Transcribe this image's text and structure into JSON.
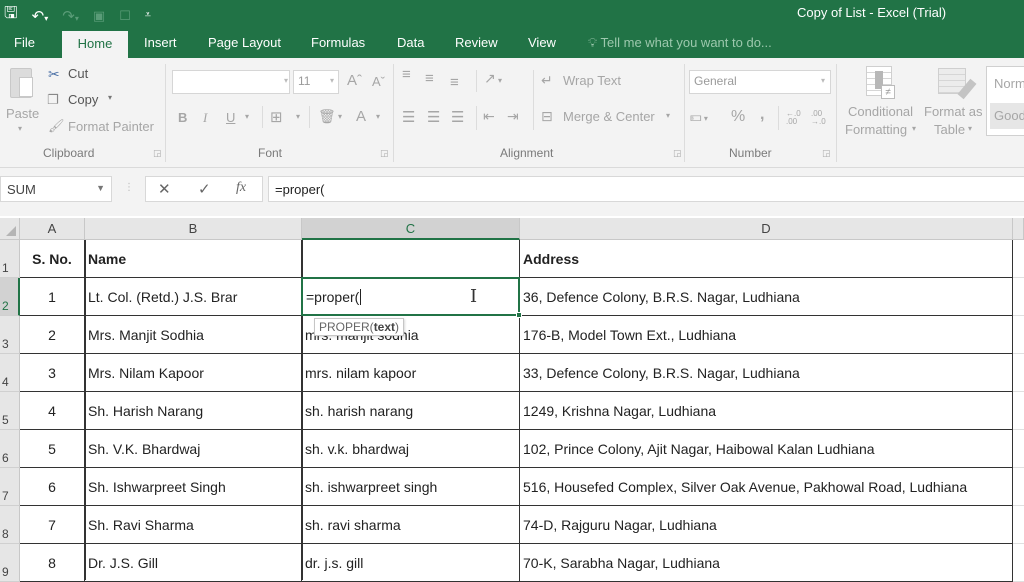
{
  "app": {
    "window_title": "Copy of List - Excel (Trial)",
    "accent_color": "#217346"
  },
  "quick_access": [
    {
      "name": "save-icon",
      "glyph": "🖫"
    },
    {
      "name": "undo-icon",
      "glyph": "↶▾"
    },
    {
      "name": "redo-icon",
      "glyph": "↷▾"
    },
    {
      "name": "camera-icon",
      "glyph": "📷"
    },
    {
      "name": "print-preview-icon",
      "glyph": "🔍"
    },
    {
      "name": "customize-qat-icon",
      "glyph": "⩡"
    }
  ],
  "tabs": [
    {
      "label": "File",
      "active": false
    },
    {
      "label": "Home",
      "active": true
    },
    {
      "label": "Insert",
      "active": false
    },
    {
      "label": "Page Layout",
      "active": false
    },
    {
      "label": "Formulas",
      "active": false
    },
    {
      "label": "Data",
      "active": false
    },
    {
      "label": "Review",
      "active": false
    },
    {
      "label": "View",
      "active": false
    }
  ],
  "tell_me": "Tell me what you want to do...",
  "ribbon": {
    "clipboard": {
      "label": "Clipboard",
      "paste": "Paste",
      "cut": "Cut",
      "copy": "Copy",
      "format_painter": "Format Painter"
    },
    "font": {
      "label": "Font",
      "font_name": "",
      "font_size": "11",
      "bold": "B",
      "italic": "I",
      "underline": "U",
      "grow": "Aˆ",
      "shrink": "Aˇ",
      "font_color": "A"
    },
    "alignment": {
      "label": "Alignment",
      "wrap_text": "Wrap Text",
      "merge_center": "Merge & Center"
    },
    "number": {
      "label": "Number",
      "format": "General",
      "percent": "%",
      "comma": ",",
      "inc_decimal": "←.0 .00",
      "dec_decimal": ".00 →.0"
    },
    "styles": {
      "conditional_formatting_1": "Conditional",
      "conditional_formatting_2": "Formatting",
      "format_as_table_1": "Format as",
      "format_as_table_2": "Table",
      "style_normal": "Norm",
      "style_good": "Good"
    }
  },
  "formula_bar": {
    "name_box": "SUM",
    "cancel": "✕",
    "enter": "✓",
    "fx": "fx",
    "formula": "=proper("
  },
  "sheet": {
    "columns": [
      "A",
      "B",
      "C",
      "D"
    ],
    "selected_column": "C",
    "rows": [
      {
        "row": "1",
        "a": "S. No.",
        "b": "Name",
        "c": "",
        "d": "Address"
      },
      {
        "row": "2",
        "a": "1",
        "b": "Lt. Col. (Retd.) J.S. Brar",
        "c": "=proper(",
        "d": "36, Defence Colony, B.R.S. Nagar, Ludhiana"
      },
      {
        "row": "3",
        "a": "2",
        "b": "Mrs. Manjit Sodhia",
        "c": "mrs. manjit sodhia",
        "d": "176-B, Model Town Ext., Ludhiana"
      },
      {
        "row": "4",
        "a": "3",
        "b": "Mrs. Nilam Kapoor",
        "c": "mrs. nilam kapoor",
        "d": "33, Defence Colony, B.R.S. Nagar, Ludhiana"
      },
      {
        "row": "5",
        "a": "4",
        "b": "Sh. Harish Narang",
        "c": "sh. harish narang",
        "d": "1249, Krishna Nagar, Ludhiana"
      },
      {
        "row": "6",
        "a": "5",
        "b": "Sh. V.K. Bhardwaj",
        "c": "sh. v.k. bhardwaj",
        "d": "102, Prince Colony, Ajit Nagar, Haibowal Kalan Ludhiana"
      },
      {
        "row": "7",
        "a": "6",
        "b": "Sh. Ishwarpreet Singh",
        "c": "sh. ishwarpreet singh",
        "d": "516, Housefed Complex, Silver Oak Avenue, Pakhowal Road, Ludhiana"
      },
      {
        "row": "8",
        "a": "7",
        "b": "Sh. Ravi Sharma",
        "c": "sh. ravi sharma",
        "d": "74-D, Rajguru Nagar, Ludhiana"
      },
      {
        "row": "9",
        "a": "8",
        "b": "Dr. J.S. Gill",
        "c": "dr. j.s. gill",
        "d": "70-K, Sarabha Nagar, Ludhiana"
      }
    ],
    "active_cell": "C2",
    "tooltip": {
      "func": "PROPER(",
      "arg": "text",
      "close": ")"
    }
  }
}
